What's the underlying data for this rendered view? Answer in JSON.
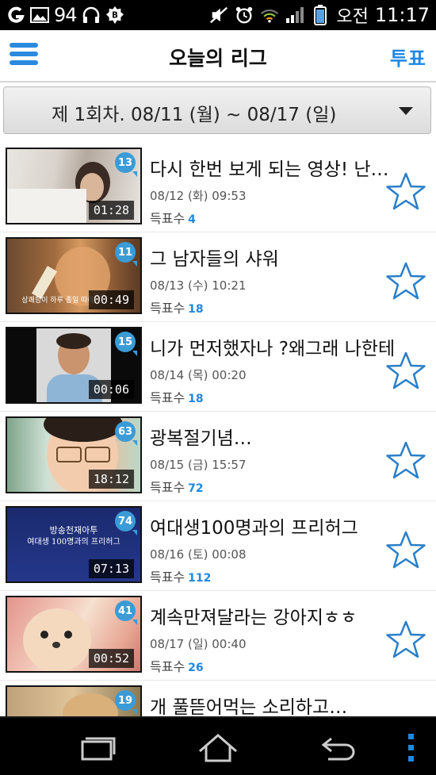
{
  "status_bar": {
    "notif_number": "94",
    "ampm": "오전",
    "time": "11:17",
    "icons": [
      "g-icon",
      "image-icon",
      "headset-icon",
      "b-badge-icon",
      "mute-icon",
      "alarm-icon",
      "wifi-icon",
      "signal-icon",
      "battery-icon"
    ]
  },
  "app_bar": {
    "title": "오늘의 리그",
    "vote_label": "투표"
  },
  "week_selector": {
    "label": "제 1회차. 08/11 (월) ~ 08/17 (일)"
  },
  "vote_prefix": "득표수",
  "videos": [
    {
      "title": "다시 한번 보게 되는 영상! 난…",
      "date": "08/12 (화) 09:53",
      "votes": "4",
      "duration": "01:28",
      "count": "13"
    },
    {
      "title": "그 남자들의 샤워",
      "date": "08/13 (수) 10:21",
      "votes": "18",
      "duration": "00:49",
      "count": "11",
      "caption": "상쾌함이 하루 종일 따라"
    },
    {
      "title": "니가 먼저했자나 ?왜그래 나한테",
      "date": "08/14 (목) 00:20",
      "votes": "18",
      "duration": "00:06",
      "count": "15"
    },
    {
      "title": "광복절기념…",
      "date": "08/15 (금) 15:57",
      "votes": "72",
      "duration": "18:12",
      "count": "63"
    },
    {
      "title": "여대생100명과의 프리허그",
      "date": "08/16 (토) 00:08",
      "votes": "112",
      "duration": "07:13",
      "count": "74",
      "caption_line1": "방송천재아투",
      "caption_line2": "여대생 100명과의 프리허그"
    },
    {
      "title": "계속만져달라는 강아지ㅎㅎ",
      "date": "08/17 (일) 00:40",
      "votes": "26",
      "duration": "00:52",
      "count": "41"
    },
    {
      "title": "개 풀뜯어먹는 소리하고…",
      "count": "19"
    }
  ],
  "colors": {
    "accent": "#1e88e5",
    "badge": "#3b9bd6",
    "star": "#2a7fc8"
  }
}
